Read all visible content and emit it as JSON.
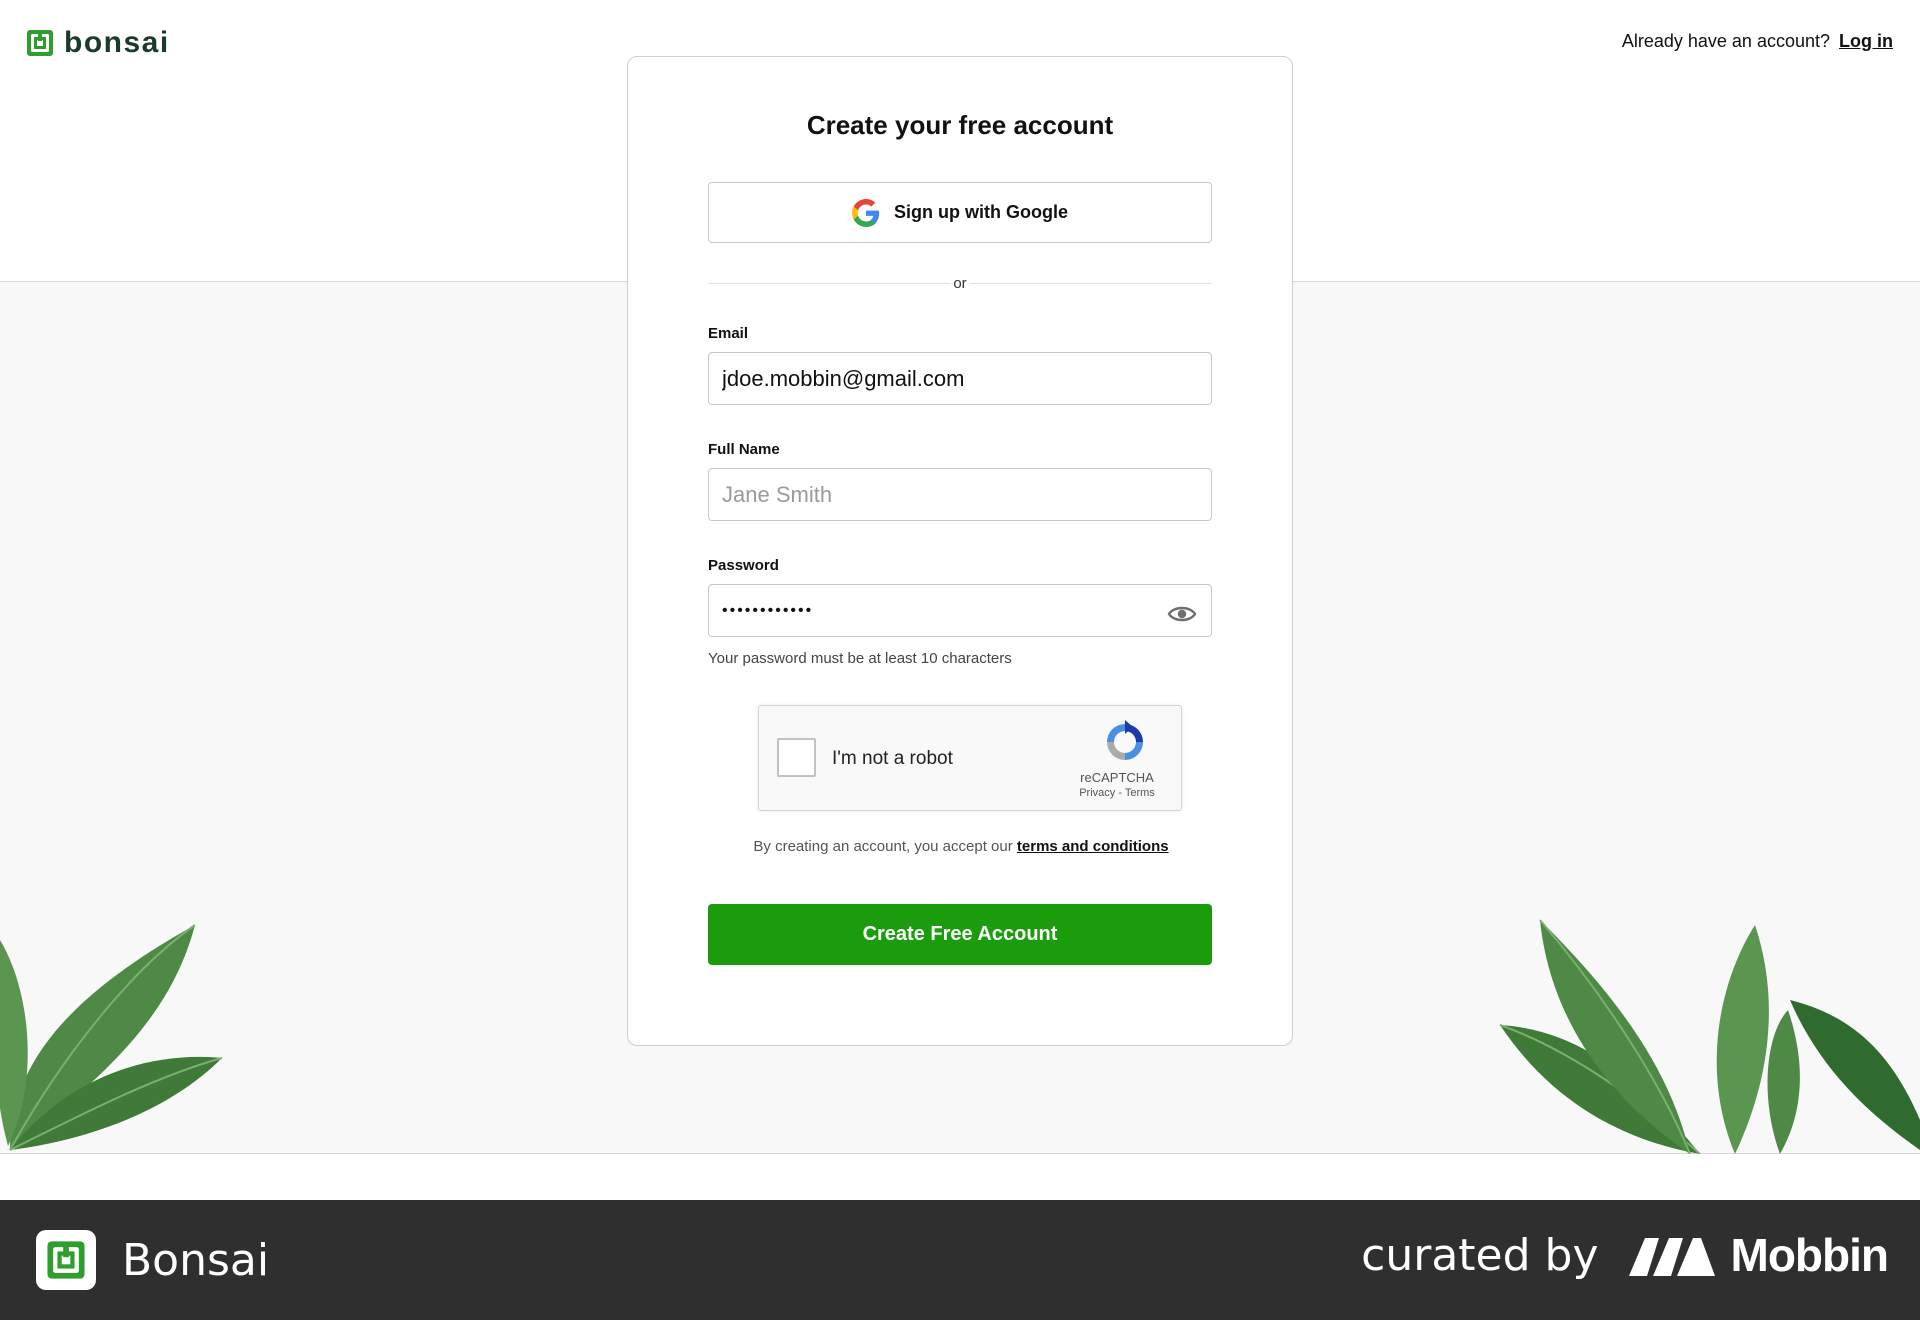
{
  "header": {
    "logo_text": "bonsai",
    "login_prompt": "Already have an account?",
    "login_link": "Log in"
  },
  "form": {
    "title": "Create your free account",
    "google_button": "Sign up with Google",
    "divider": "or",
    "email": {
      "label": "Email",
      "value": "jdoe.mobbin@gmail.com"
    },
    "full_name": {
      "label": "Full Name",
      "placeholder": "Jane Smith"
    },
    "password": {
      "label": "Password",
      "value": "••••••••••••",
      "hint": "Your password must be at least 10 characters"
    },
    "captcha": {
      "label": "I'm not a robot",
      "brand": "reCAPTCHA",
      "links": "Privacy - Terms"
    },
    "terms_prefix": "By creating an account, you accept our",
    "terms_link": "terms and conditions",
    "submit": "Create Free Account"
  },
  "footer": {
    "app_name": "Bonsai",
    "curated_by": "curated by",
    "brand": "Mobbin"
  },
  "colors": {
    "brand_green": "#1b9c0d",
    "logo_green": "#2e9e2e",
    "footer_bg": "#2f2f2f",
    "leaf_green": "#4e8a45"
  },
  "icons": [
    "bonsai-logo-icon",
    "google-icon",
    "eye-icon",
    "recaptcha-icon",
    "mobbin-logo-icon"
  ]
}
